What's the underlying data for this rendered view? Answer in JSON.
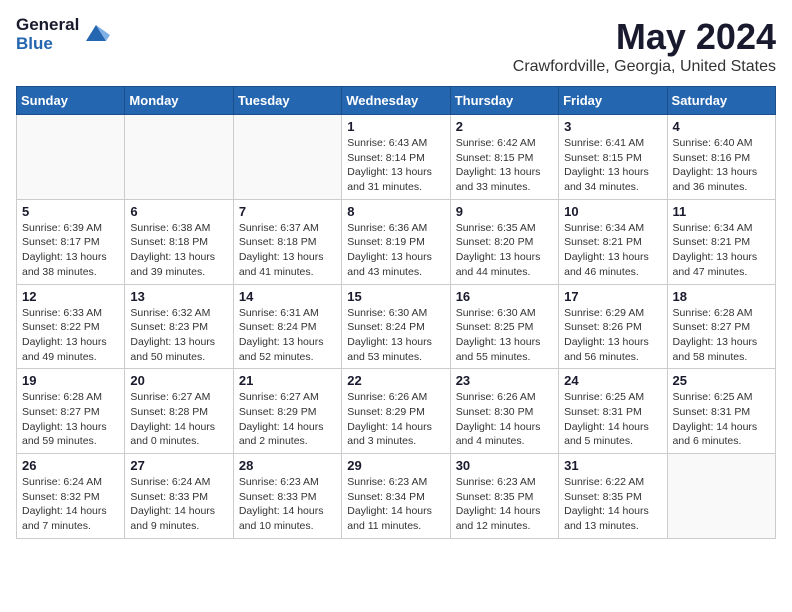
{
  "header": {
    "logo_general": "General",
    "logo_blue": "Blue",
    "month": "May 2024",
    "location": "Crawfordville, Georgia, United States"
  },
  "weekdays": [
    "Sunday",
    "Monday",
    "Tuesday",
    "Wednesday",
    "Thursday",
    "Friday",
    "Saturday"
  ],
  "weeks": [
    [
      {
        "day": "",
        "info": ""
      },
      {
        "day": "",
        "info": ""
      },
      {
        "day": "",
        "info": ""
      },
      {
        "day": "1",
        "info": "Sunrise: 6:43 AM\nSunset: 8:14 PM\nDaylight: 13 hours\nand 31 minutes."
      },
      {
        "day": "2",
        "info": "Sunrise: 6:42 AM\nSunset: 8:15 PM\nDaylight: 13 hours\nand 33 minutes."
      },
      {
        "day": "3",
        "info": "Sunrise: 6:41 AM\nSunset: 8:15 PM\nDaylight: 13 hours\nand 34 minutes."
      },
      {
        "day": "4",
        "info": "Sunrise: 6:40 AM\nSunset: 8:16 PM\nDaylight: 13 hours\nand 36 minutes."
      }
    ],
    [
      {
        "day": "5",
        "info": "Sunrise: 6:39 AM\nSunset: 8:17 PM\nDaylight: 13 hours\nand 38 minutes."
      },
      {
        "day": "6",
        "info": "Sunrise: 6:38 AM\nSunset: 8:18 PM\nDaylight: 13 hours\nand 39 minutes."
      },
      {
        "day": "7",
        "info": "Sunrise: 6:37 AM\nSunset: 8:18 PM\nDaylight: 13 hours\nand 41 minutes."
      },
      {
        "day": "8",
        "info": "Sunrise: 6:36 AM\nSunset: 8:19 PM\nDaylight: 13 hours\nand 43 minutes."
      },
      {
        "day": "9",
        "info": "Sunrise: 6:35 AM\nSunset: 8:20 PM\nDaylight: 13 hours\nand 44 minutes."
      },
      {
        "day": "10",
        "info": "Sunrise: 6:34 AM\nSunset: 8:21 PM\nDaylight: 13 hours\nand 46 minutes."
      },
      {
        "day": "11",
        "info": "Sunrise: 6:34 AM\nSunset: 8:21 PM\nDaylight: 13 hours\nand 47 minutes."
      }
    ],
    [
      {
        "day": "12",
        "info": "Sunrise: 6:33 AM\nSunset: 8:22 PM\nDaylight: 13 hours\nand 49 minutes."
      },
      {
        "day": "13",
        "info": "Sunrise: 6:32 AM\nSunset: 8:23 PM\nDaylight: 13 hours\nand 50 minutes."
      },
      {
        "day": "14",
        "info": "Sunrise: 6:31 AM\nSunset: 8:24 PM\nDaylight: 13 hours\nand 52 minutes."
      },
      {
        "day": "15",
        "info": "Sunrise: 6:30 AM\nSunset: 8:24 PM\nDaylight: 13 hours\nand 53 minutes."
      },
      {
        "day": "16",
        "info": "Sunrise: 6:30 AM\nSunset: 8:25 PM\nDaylight: 13 hours\nand 55 minutes."
      },
      {
        "day": "17",
        "info": "Sunrise: 6:29 AM\nSunset: 8:26 PM\nDaylight: 13 hours\nand 56 minutes."
      },
      {
        "day": "18",
        "info": "Sunrise: 6:28 AM\nSunset: 8:27 PM\nDaylight: 13 hours\nand 58 minutes."
      }
    ],
    [
      {
        "day": "19",
        "info": "Sunrise: 6:28 AM\nSunset: 8:27 PM\nDaylight: 13 hours\nand 59 minutes."
      },
      {
        "day": "20",
        "info": "Sunrise: 6:27 AM\nSunset: 8:28 PM\nDaylight: 14 hours\nand 0 minutes."
      },
      {
        "day": "21",
        "info": "Sunrise: 6:27 AM\nSunset: 8:29 PM\nDaylight: 14 hours\nand 2 minutes."
      },
      {
        "day": "22",
        "info": "Sunrise: 6:26 AM\nSunset: 8:29 PM\nDaylight: 14 hours\nand 3 minutes."
      },
      {
        "day": "23",
        "info": "Sunrise: 6:26 AM\nSunset: 8:30 PM\nDaylight: 14 hours\nand 4 minutes."
      },
      {
        "day": "24",
        "info": "Sunrise: 6:25 AM\nSunset: 8:31 PM\nDaylight: 14 hours\nand 5 minutes."
      },
      {
        "day": "25",
        "info": "Sunrise: 6:25 AM\nSunset: 8:31 PM\nDaylight: 14 hours\nand 6 minutes."
      }
    ],
    [
      {
        "day": "26",
        "info": "Sunrise: 6:24 AM\nSunset: 8:32 PM\nDaylight: 14 hours\nand 7 minutes."
      },
      {
        "day": "27",
        "info": "Sunrise: 6:24 AM\nSunset: 8:33 PM\nDaylight: 14 hours\nand 9 minutes."
      },
      {
        "day": "28",
        "info": "Sunrise: 6:23 AM\nSunset: 8:33 PM\nDaylight: 14 hours\nand 10 minutes."
      },
      {
        "day": "29",
        "info": "Sunrise: 6:23 AM\nSunset: 8:34 PM\nDaylight: 14 hours\nand 11 minutes."
      },
      {
        "day": "30",
        "info": "Sunrise: 6:23 AM\nSunset: 8:35 PM\nDaylight: 14 hours\nand 12 minutes."
      },
      {
        "day": "31",
        "info": "Sunrise: 6:22 AM\nSunset: 8:35 PM\nDaylight: 14 hours\nand 13 minutes."
      },
      {
        "day": "",
        "info": ""
      }
    ]
  ]
}
